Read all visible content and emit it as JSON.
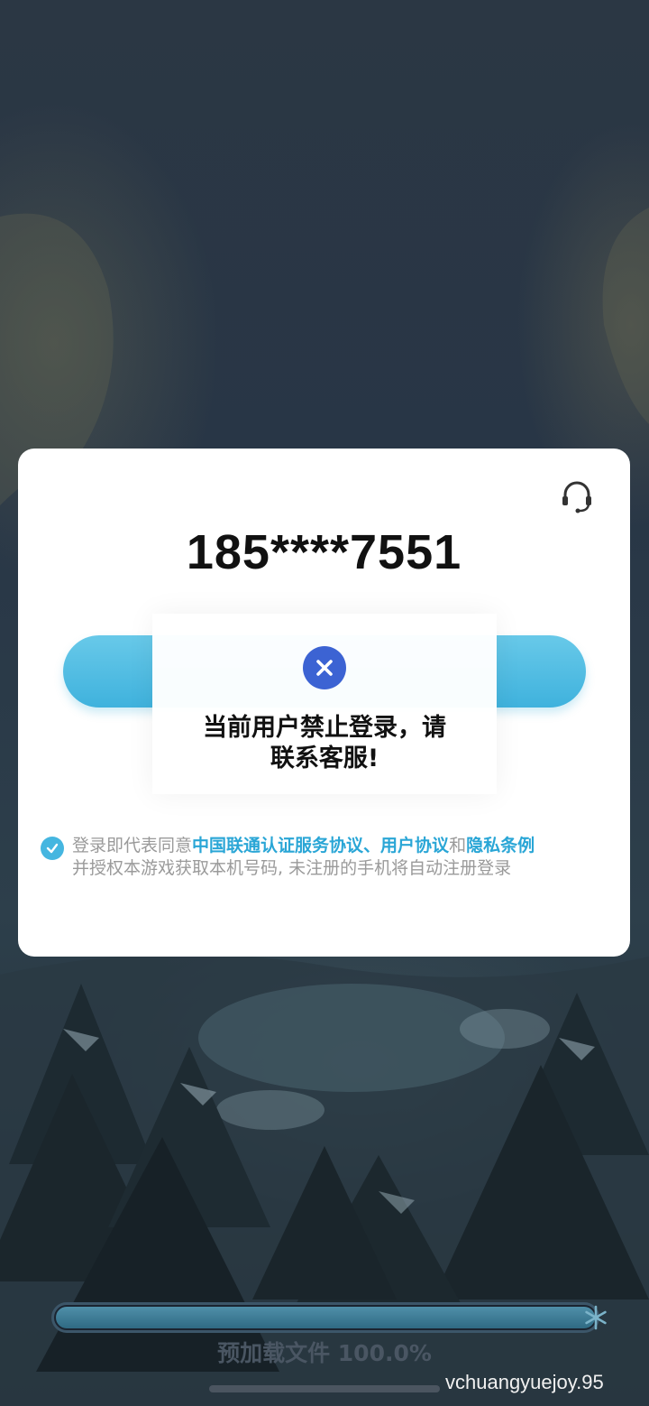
{
  "dialog": {
    "phone_number": "185****7551",
    "support_icon": "headset-icon",
    "agreement": {
      "checked": true,
      "check_icon": "checkmark-icon",
      "prefix": "登录即代表同意",
      "link_unicom": "中国联通认证服务协议",
      "sep1": "、",
      "link_user": "用户协议",
      "sep2": "和",
      "link_privacy": "隐私条例",
      "line2": "并授权本游戏获取本机号码, 未注册的手机将自动注册登录"
    }
  },
  "toast": {
    "icon": "error-x-icon",
    "message_line1": "当前用户禁止登录，请",
    "message_line2": "联系客服!"
  },
  "loading": {
    "label": "预加载文件 100.0%",
    "progress": 1.0,
    "end_icon": "snowflake-icon"
  },
  "watermark": "vchuangyuejoy.95",
  "colors": {
    "accent": "#45b6e0",
    "link": "#2aa6d6",
    "error_icon": "#3c63d3",
    "button": "#4fbde4"
  }
}
